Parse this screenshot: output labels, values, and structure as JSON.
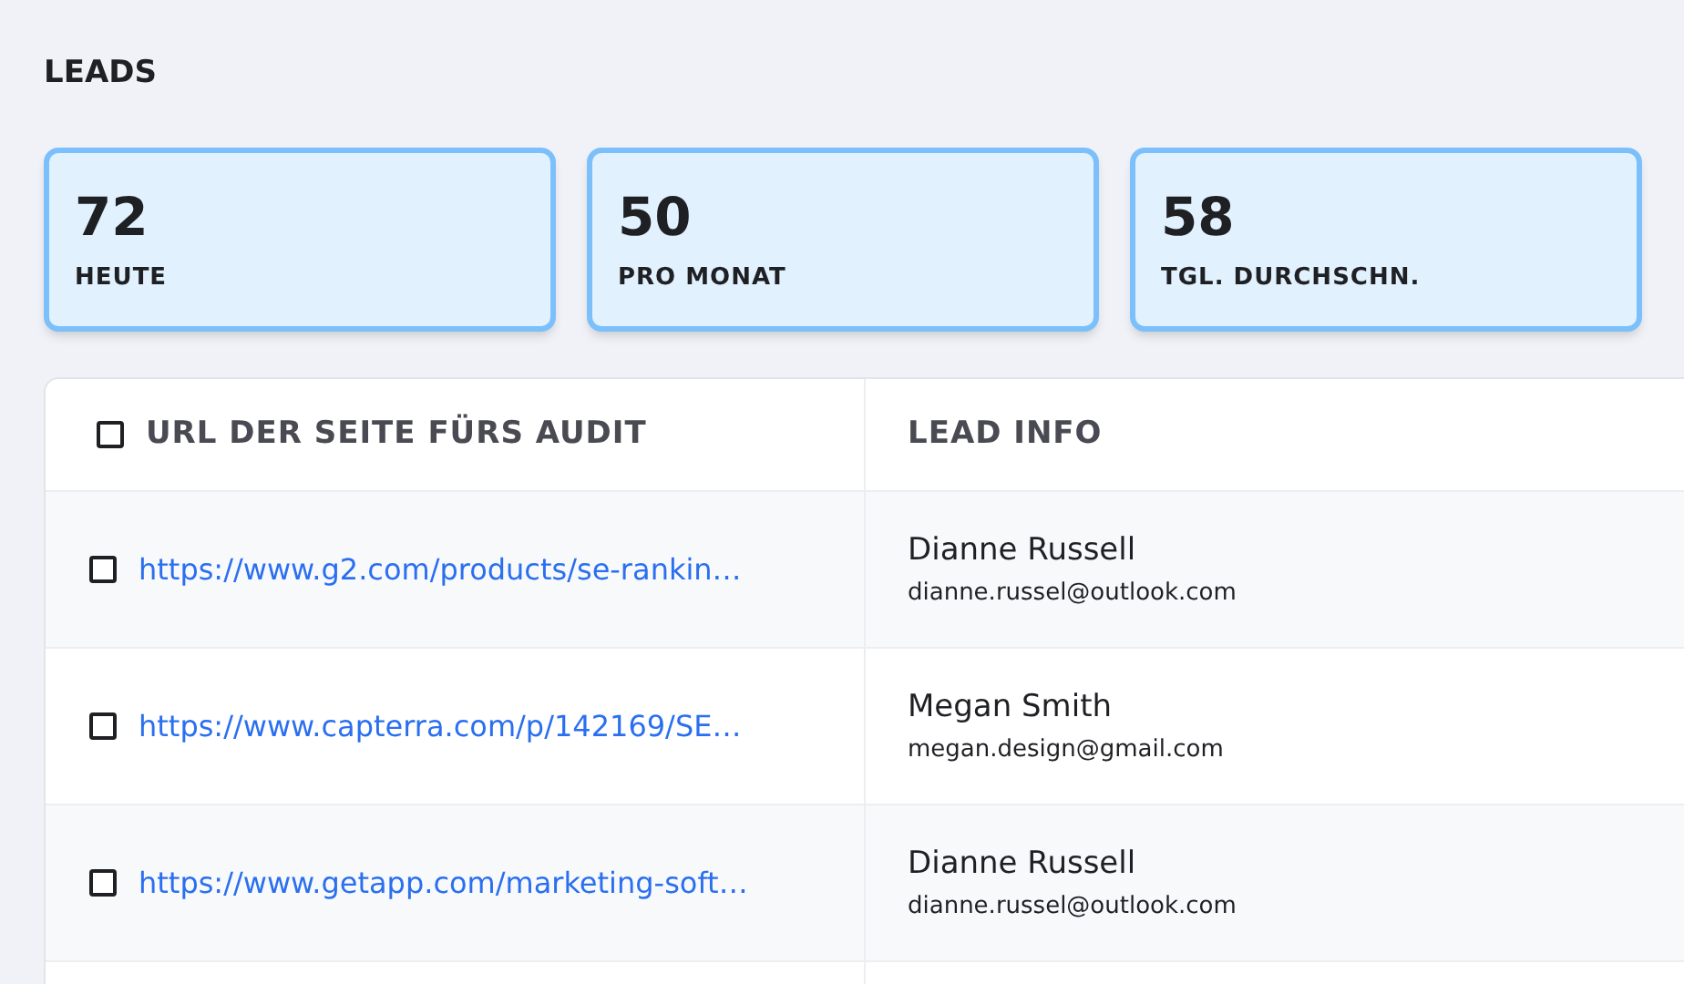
{
  "title": "LEADS",
  "stats": [
    {
      "value": "72",
      "label": "HEUTE"
    },
    {
      "value": "50",
      "label": "PRO MONAT"
    },
    {
      "value": "58",
      "label": "TGL. DURCHSCHN."
    }
  ],
  "table": {
    "select_all": {
      "checked": false
    },
    "columns": [
      "URL DER SEITE FÜRS AUDIT",
      "LEAD INFO"
    ],
    "rows": [
      {
        "checked": false,
        "url": "https://www.g2.com/products/se-rankin…",
        "name": "Dianne Russell",
        "email": "dianne.russel@outlook.com"
      },
      {
        "checked": false,
        "url": "https://www.capterra.com/p/142169/SE…",
        "name": "Megan Smith",
        "email": "megan.design@gmail.com"
      },
      {
        "checked": false,
        "url": "https://www.getapp.com/marketing-soft…",
        "name": "Dianne Russell",
        "email": "dianne.russel@outlook.com"
      }
    ]
  }
}
